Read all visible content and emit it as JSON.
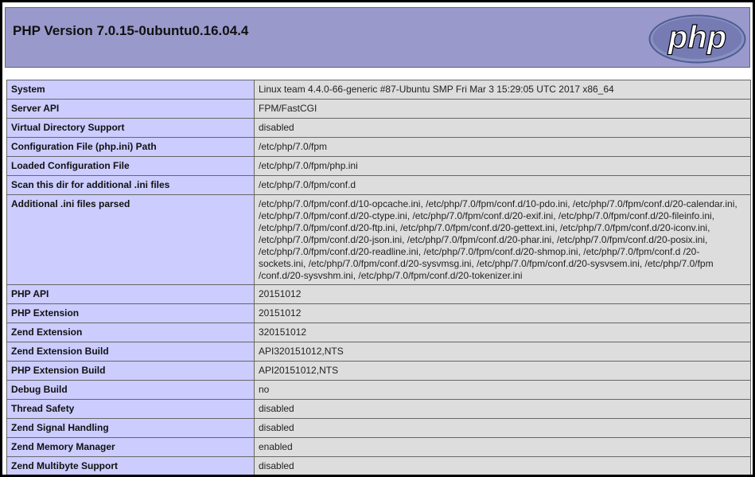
{
  "header": {
    "title": "PHP Version 7.0.15-0ubuntu0.16.04.4",
    "logo_text": "php"
  },
  "rows": [
    {
      "key": "System",
      "value": "Linux team 4.4.0-66-generic #87-Ubuntu SMP Fri Mar 3 15:29:05 UTC 2017 x86_64"
    },
    {
      "key": "Server API",
      "value": "FPM/FastCGI"
    },
    {
      "key": "Virtual Directory Support",
      "value": "disabled"
    },
    {
      "key": "Configuration File (php.ini) Path",
      "value": "/etc/php/7.0/fpm"
    },
    {
      "key": "Loaded Configuration File",
      "value": "/etc/php/7.0/fpm/php.ini"
    },
    {
      "key": "Scan this dir for additional .ini files",
      "value": "/etc/php/7.0/fpm/conf.d"
    },
    {
      "key": "Additional .ini files parsed",
      "value": "/etc/php/7.0/fpm/conf.d/10-opcache.ini, /etc/php/7.0/fpm/conf.d/10-pdo.ini, /etc/php/7.0/fpm/conf.d/20-calendar.ini, /etc/php/7.0/fpm/conf.d/20-ctype.ini, /etc/php/7.0/fpm/conf.d/20-exif.ini, /etc/php/7.0/fpm/conf.d/20-fileinfo.ini, /etc/php/7.0/fpm/conf.d/20-ftp.ini, /etc/php/7.0/fpm/conf.d/20-gettext.ini, /etc/php/7.0/fpm/conf.d/20-iconv.ini, /etc/php/7.0/fpm/conf.d/20-json.ini, /etc/php/7.0/fpm/conf.d/20-phar.ini, /etc/php/7.0/fpm/conf.d/20-posix.ini, /etc/php/7.0/fpm/conf.d/20-readline.ini, /etc/php/7.0/fpm/conf.d/20-shmop.ini, /etc/php/7.0/fpm/conf.d /20-sockets.ini, /etc/php/7.0/fpm/conf.d/20-sysvmsg.ini, /etc/php/7.0/fpm/conf.d/20-sysvsem.ini, /etc/php/7.0/fpm /conf.d/20-sysvshm.ini, /etc/php/7.0/fpm/conf.d/20-tokenizer.ini"
    },
    {
      "key": "PHP API",
      "value": "20151012"
    },
    {
      "key": "PHP Extension",
      "value": "20151012"
    },
    {
      "key": "Zend Extension",
      "value": "320151012"
    },
    {
      "key": "Zend Extension Build",
      "value": "API320151012,NTS"
    },
    {
      "key": "PHP Extension Build",
      "value": "API20151012,NTS"
    },
    {
      "key": "Debug Build",
      "value": "no"
    },
    {
      "key": "Thread Safety",
      "value": "disabled"
    },
    {
      "key": "Zend Signal Handling",
      "value": "disabled"
    },
    {
      "key": "Zend Memory Manager",
      "value": "enabled"
    },
    {
      "key": "Zend Multibyte Support",
      "value": "disabled"
    }
  ],
  "colors": {
    "header_bg": "#9999cc",
    "key_bg": "#ccccff",
    "value_bg": "#dddddd",
    "logo_fill": "#777bb4",
    "logo_text": "#000000"
  }
}
